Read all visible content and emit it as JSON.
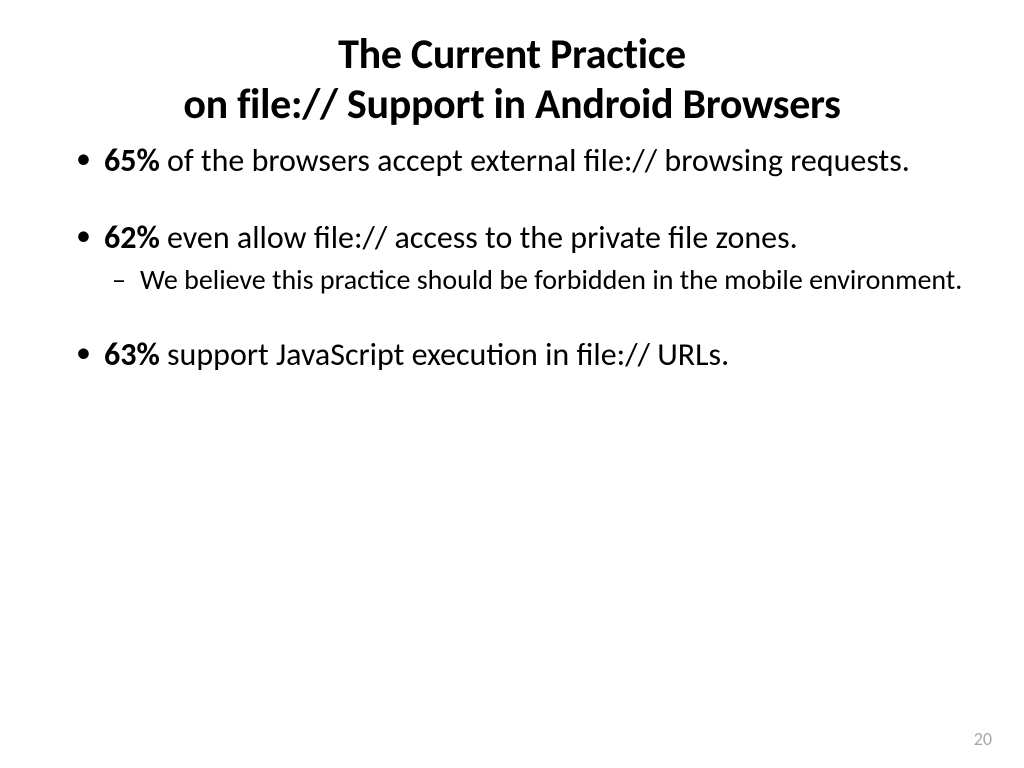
{
  "title": {
    "line1": "The Current Practice",
    "line2": "on file:// Support in Android Browsers"
  },
  "bullets": [
    {
      "stat": "65%",
      "text": " of the browsers accept external file:// browsing requests."
    },
    {
      "stat": "62%",
      "text": " even allow file:// access to the private file zones.",
      "sub": "We believe this practice should be forbidden in the mobile environment."
    },
    {
      "stat": "63%",
      "text": " support JavaScript execution in file:// URLs."
    }
  ],
  "pageNumber": "20"
}
